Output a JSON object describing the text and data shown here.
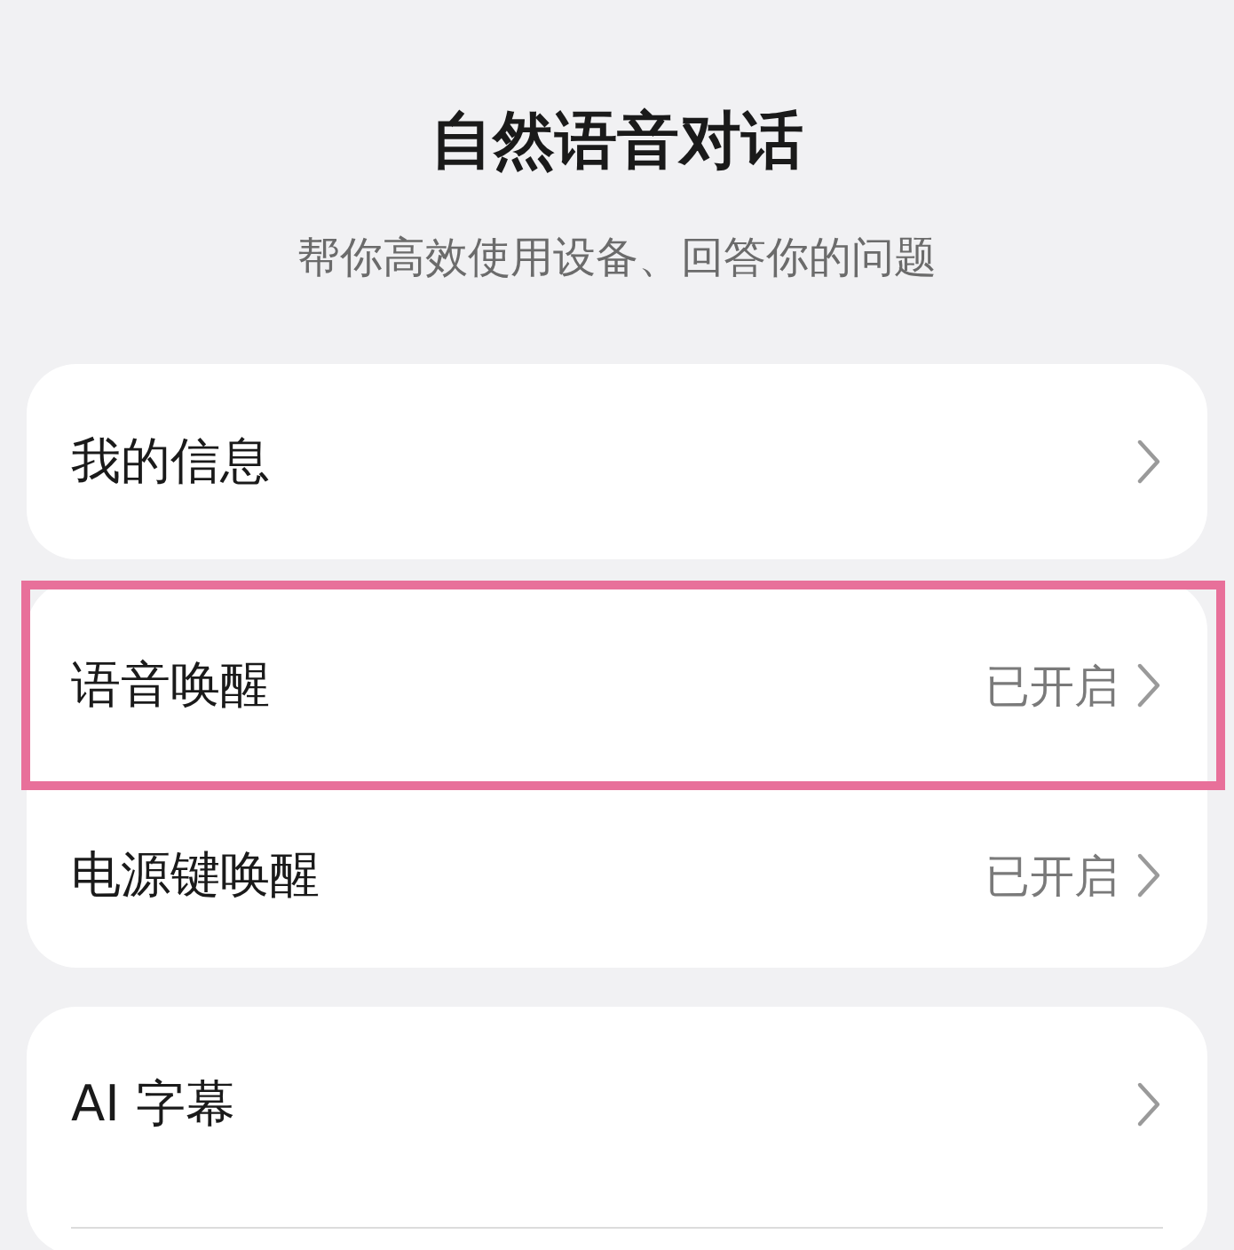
{
  "header": {
    "title": "自然语音对话",
    "subtitle": "帮你高效使用设备、回答你的问题"
  },
  "cards": [
    {
      "rows": [
        {
          "label": "我的信息",
          "highlighted": false
        }
      ]
    },
    {
      "rows": [
        {
          "label": "语音唤醒",
          "value": "已开启",
          "highlighted": true
        },
        {
          "label": "电源键唤醒",
          "value": "已开启",
          "highlighted": false
        }
      ]
    },
    {
      "rows": [
        {
          "label": "AI 字幕",
          "highlighted": false
        }
      ]
    }
  ]
}
